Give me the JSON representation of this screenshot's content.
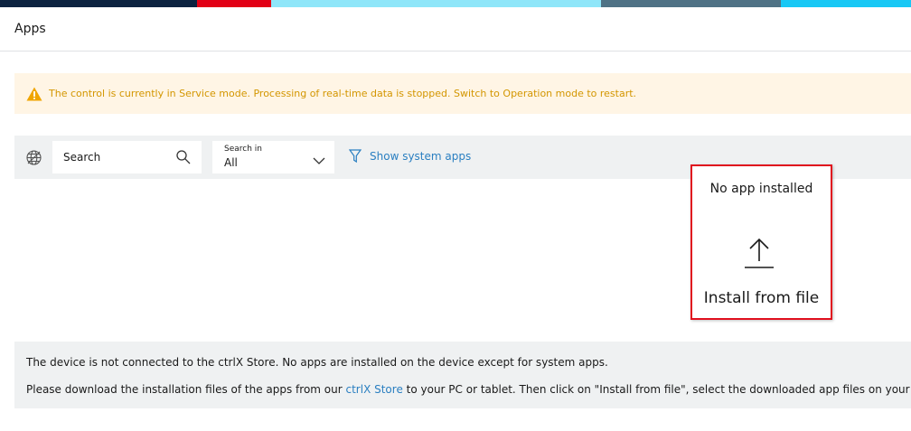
{
  "brand_colors": [
    "#0c2340",
    "#e20015",
    "#8fe6f9",
    "#4f7285",
    "#18c8f5"
  ],
  "page": {
    "title": "Apps"
  },
  "warning": {
    "icon": "warning-triangle-icon",
    "text": "The control is currently in Service mode. Processing of real-time data is stopped. Switch to Operation mode to restart."
  },
  "toolbar": {
    "globe_icon": "globe-icon",
    "search": {
      "placeholder": "Search",
      "icon": "magnifier-icon"
    },
    "search_in": {
      "label": "Search in",
      "value": "All"
    },
    "filter": {
      "icon": "filter-icon",
      "label": "Show system apps"
    }
  },
  "empty_state": {
    "message": "No app installed",
    "icon": "upload-arrow-icon",
    "action_label": "Install from file"
  },
  "info": {
    "line1": "The device is not connected to the ctrlX Store. No apps are installed on the device except for system apps.",
    "line2_prefix": "Please download the installation files of the apps from our ",
    "line2_link": "ctrlX Store",
    "line2_suffix": " to your PC or tablet. Then click on \"Install from file\", select the downloaded app files on your PC"
  }
}
